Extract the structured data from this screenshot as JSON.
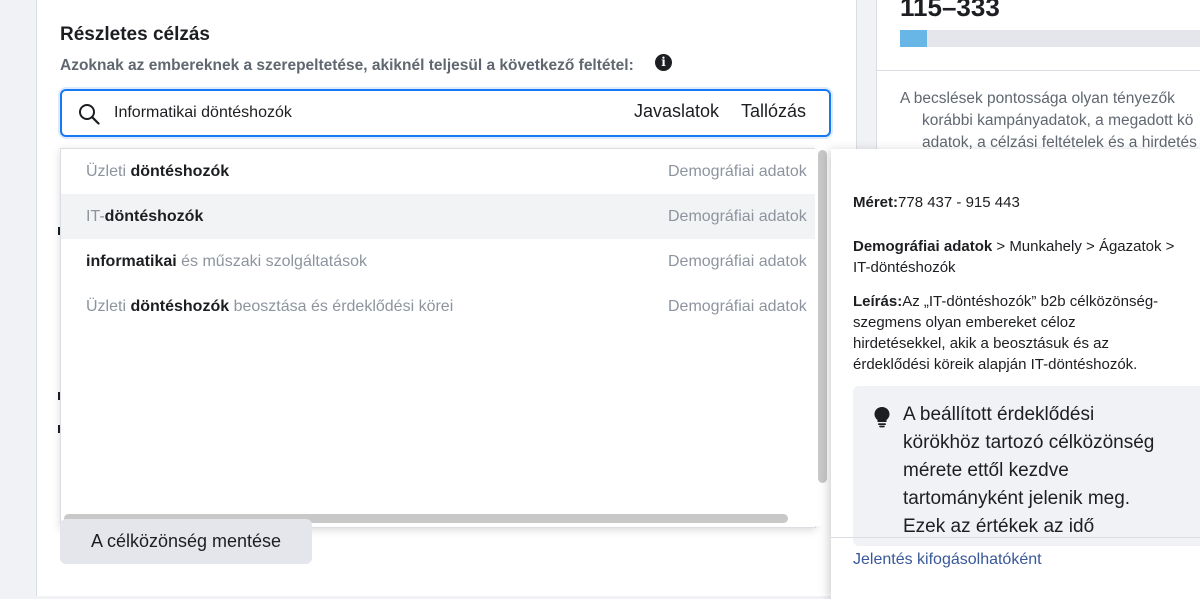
{
  "targeting": {
    "title": "Részletes célzás",
    "subtitle": "Azoknak az embereknek a szerepeltetése, akiknél teljesül a következő feltétel:",
    "info_glyph": "i",
    "search": {
      "value": "Informatikai döntéshozók",
      "tab_suggestions": "Javaslatok",
      "tab_browse": "Tallózás"
    }
  },
  "dropdown": {
    "rows": [
      {
        "parts": [
          {
            "text": "Üzleti ",
            "style": "muted"
          },
          {
            "text": "döntéshozók",
            "style": "strong"
          }
        ],
        "category": "Demográfiai adatok"
      },
      {
        "parts": [
          {
            "text": "IT-",
            "style": "muted"
          },
          {
            "text": "döntéshozók",
            "style": "strong"
          }
        ],
        "category": "Demográfiai adatok"
      },
      {
        "parts": [
          {
            "text": "informatikai",
            "style": "strong"
          },
          {
            "text": " és műszaki szolgáltatások",
            "style": "muted"
          }
        ],
        "category": "Demográfiai adatok"
      },
      {
        "parts": [
          {
            "text": "Üzleti ",
            "style": "muted"
          },
          {
            "text": "döntéshozók",
            "style": "strong"
          },
          {
            "text": " beosztása és érdeklődési körei",
            "style": "muted"
          }
        ],
        "category": "Demográfiai adatok"
      }
    ]
  },
  "save_button": "A célközönség mentése",
  "audience": {
    "range": "115–333",
    "fill_fraction": 0.09,
    "estimate_lines": [
      "A becslések pontossága olyan tényezők",
      "korábbi kampányadatok, a megadott kö",
      "adatok, a célzási feltételek és a hirdetés"
    ]
  },
  "tooltip": {
    "size_label": "Méret:",
    "size_value": "778 437 - 915 443",
    "path_bold": "Demográfiai adatok",
    "path_rest": " > Munkahely > Ágazatok >",
    "path_line2": "IT-döntéshozók",
    "desc_label": "Leírás:",
    "desc_lines": [
      "Az „IT-döntéshozók” b2b célközönség-",
      "szegmens olyan embereket céloz",
      "hirdetésekkel, akik a beosztásuk és az",
      "érdeklődési köreik alapján IT-döntéshozók."
    ],
    "note_lines": [
      "A beállított érdeklődési",
      "körökhöz tartozó célközönség",
      "mérete ettől kezdve",
      "tartományként jelenik meg.",
      "Ezek az értékek az idő"
    ],
    "report_link": "Jelentés kifogásolhatóként"
  },
  "colors": {
    "accent": "#1877f2",
    "range_fill": "#68b6e6",
    "link": "#385898"
  },
  "icons": [
    "search-icon",
    "info-icon",
    "lightbulb-icon"
  ]
}
